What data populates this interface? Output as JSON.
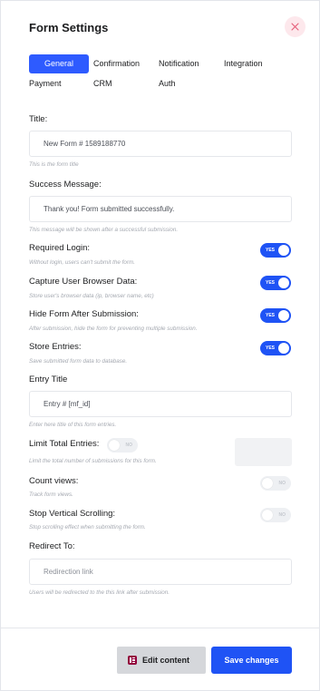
{
  "modal": {
    "title": "Form Settings"
  },
  "tabs": [
    "General",
    "Confirmation",
    "Notification",
    "Integration",
    "Payment",
    "CRM",
    "Auth"
  ],
  "fields": {
    "title": {
      "label": "Title:",
      "value": "New Form # 1589188770",
      "help": "This is the form title"
    },
    "success_message": {
      "label": "Success Message:",
      "value": "Thank you! Form submitted successfully.",
      "help": "This message will be shown after a successful submission."
    },
    "required_login": {
      "label": "Required Login:",
      "help": "Without login, users can't submit the form.",
      "toggle": "YES",
      "checked": true
    },
    "capture_browser": {
      "label": "Capture User Browser Data:",
      "help": "Store user's browser data (ip, browser name, etc)",
      "toggle": "YES",
      "checked": true
    },
    "hide_form": {
      "label": "Hide Form After Submission:",
      "help": "After submission, hide the form for preventing multiple submission.",
      "toggle": "YES",
      "checked": true
    },
    "store_entries": {
      "label": "Store Entries:",
      "help": "Save submitted form data to database.",
      "toggle": "YES",
      "checked": true
    },
    "entry_title": {
      "label": "Entry Title",
      "value": "Entry # [mf_id]",
      "help": "Enter here title of this form entries."
    },
    "limit_entries": {
      "label": "Limit Total Entries:",
      "help": "Limit the total number of submissions for this form.",
      "toggle": "NO",
      "checked": false
    },
    "count_views": {
      "label": "Count views:",
      "help": "Track form views.",
      "toggle": "NO",
      "checked": false
    },
    "stop_scrolling": {
      "label": "Stop Vertical Scrolling:",
      "help": "Stop scrolling effect when submitting the form.",
      "toggle": "NO",
      "checked": false
    },
    "redirect_to": {
      "label": "Redirect To:",
      "placeholder": "Redirection link",
      "help": "Users will be redirected to the this link after submission."
    }
  },
  "footer": {
    "edit_label": "Edit content",
    "save_label": "Save changes"
  },
  "colors": {
    "accent": "#1f53f5",
    "close_bg": "#fde8ec",
    "close_icon": "#e55c78",
    "elementor": "#92003b"
  }
}
